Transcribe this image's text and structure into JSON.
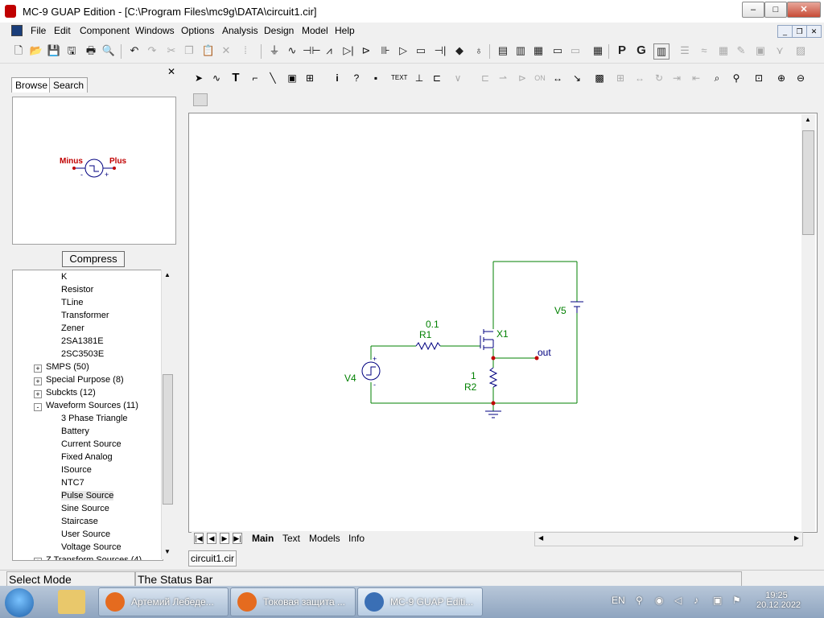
{
  "window": {
    "title": "MC-9 GUAP Edition - [C:\\Program Files\\mc9g\\DATA\\circuit1.cir]",
    "minimize": "–",
    "maximize": "□",
    "close": "✕"
  },
  "menu": [
    "File",
    "Edit",
    "Component",
    "Windows",
    "Options",
    "Analysis",
    "Design",
    "Model",
    "Help"
  ],
  "mdi": {
    "minimize": "_",
    "restore": "❐",
    "close": "✕"
  },
  "panel": {
    "close": "✕",
    "tabs": [
      "Browse",
      "Search"
    ],
    "preview": {
      "minus": "Minus",
      "plus": "Plus",
      "minus_sign": "-",
      "plus_sign": "+"
    },
    "compress_label": "Compress",
    "tree": [
      {
        "label": "K",
        "indent": 2
      },
      {
        "label": "Resistor",
        "indent": 2
      },
      {
        "label": "TLine",
        "indent": 2
      },
      {
        "label": "Transformer",
        "indent": 2
      },
      {
        "label": "Zener",
        "indent": 2
      },
      {
        "label": "2SA1381E",
        "indent": 2
      },
      {
        "label": "2SC3503E",
        "indent": 2
      },
      {
        "label": "SMPS (50)",
        "indent": 1,
        "expander": "+"
      },
      {
        "label": "Special Purpose (8)",
        "indent": 1,
        "expander": "+"
      },
      {
        "label": "Subckts (12)",
        "indent": 1,
        "expander": "+"
      },
      {
        "label": "Waveform Sources (11)",
        "indent": 1,
        "expander": "-"
      },
      {
        "label": "3 Phase Triangle",
        "indent": 2
      },
      {
        "label": "Battery",
        "indent": 2
      },
      {
        "label": "Current Source",
        "indent": 2
      },
      {
        "label": "Fixed Analog",
        "indent": 2
      },
      {
        "label": "ISource",
        "indent": 2
      },
      {
        "label": "NTC7",
        "indent": 2
      },
      {
        "label": "Pulse Source",
        "indent": 2,
        "selected": true
      },
      {
        "label": "Sine Source",
        "indent": 2
      },
      {
        "label": "Staircase",
        "indent": 2
      },
      {
        "label": "User Source",
        "indent": 2
      },
      {
        "label": "Voltage Source",
        "indent": 2
      },
      {
        "label": "Z Transform Sources (4)",
        "indent": 1,
        "expander": "+"
      }
    ]
  },
  "schematic": {
    "V4": "V4",
    "V5": "V5",
    "R1": "R1",
    "R1_value": "0.1",
    "R2": "R2",
    "R2_value": "1",
    "X1": "X1",
    "out": "out",
    "plus": "+",
    "minus": "-"
  },
  "bottom_tabs": [
    "Main",
    "Text",
    "Models",
    "Info"
  ],
  "file_tab": "circuit1.cir",
  "status": {
    "mode": "Select Mode",
    "bar": "The Status Bar"
  },
  "taskbar": [
    {
      "label": "Артемий Лебеде...",
      "color": "#e56b1f"
    },
    {
      "label": "Токовая защита ...",
      "color": "#e56b1f"
    },
    {
      "label": "MC-9 GUAP Editi...",
      "color": "#3a6fb5"
    }
  ],
  "tray": {
    "lang": "EN",
    "time": "19:25",
    "date": "20.12.2022"
  },
  "colors": {
    "wire": "#008000",
    "component": "#000080",
    "label": "#008000",
    "node": "#c00000",
    "preview_text": "#c00000"
  }
}
